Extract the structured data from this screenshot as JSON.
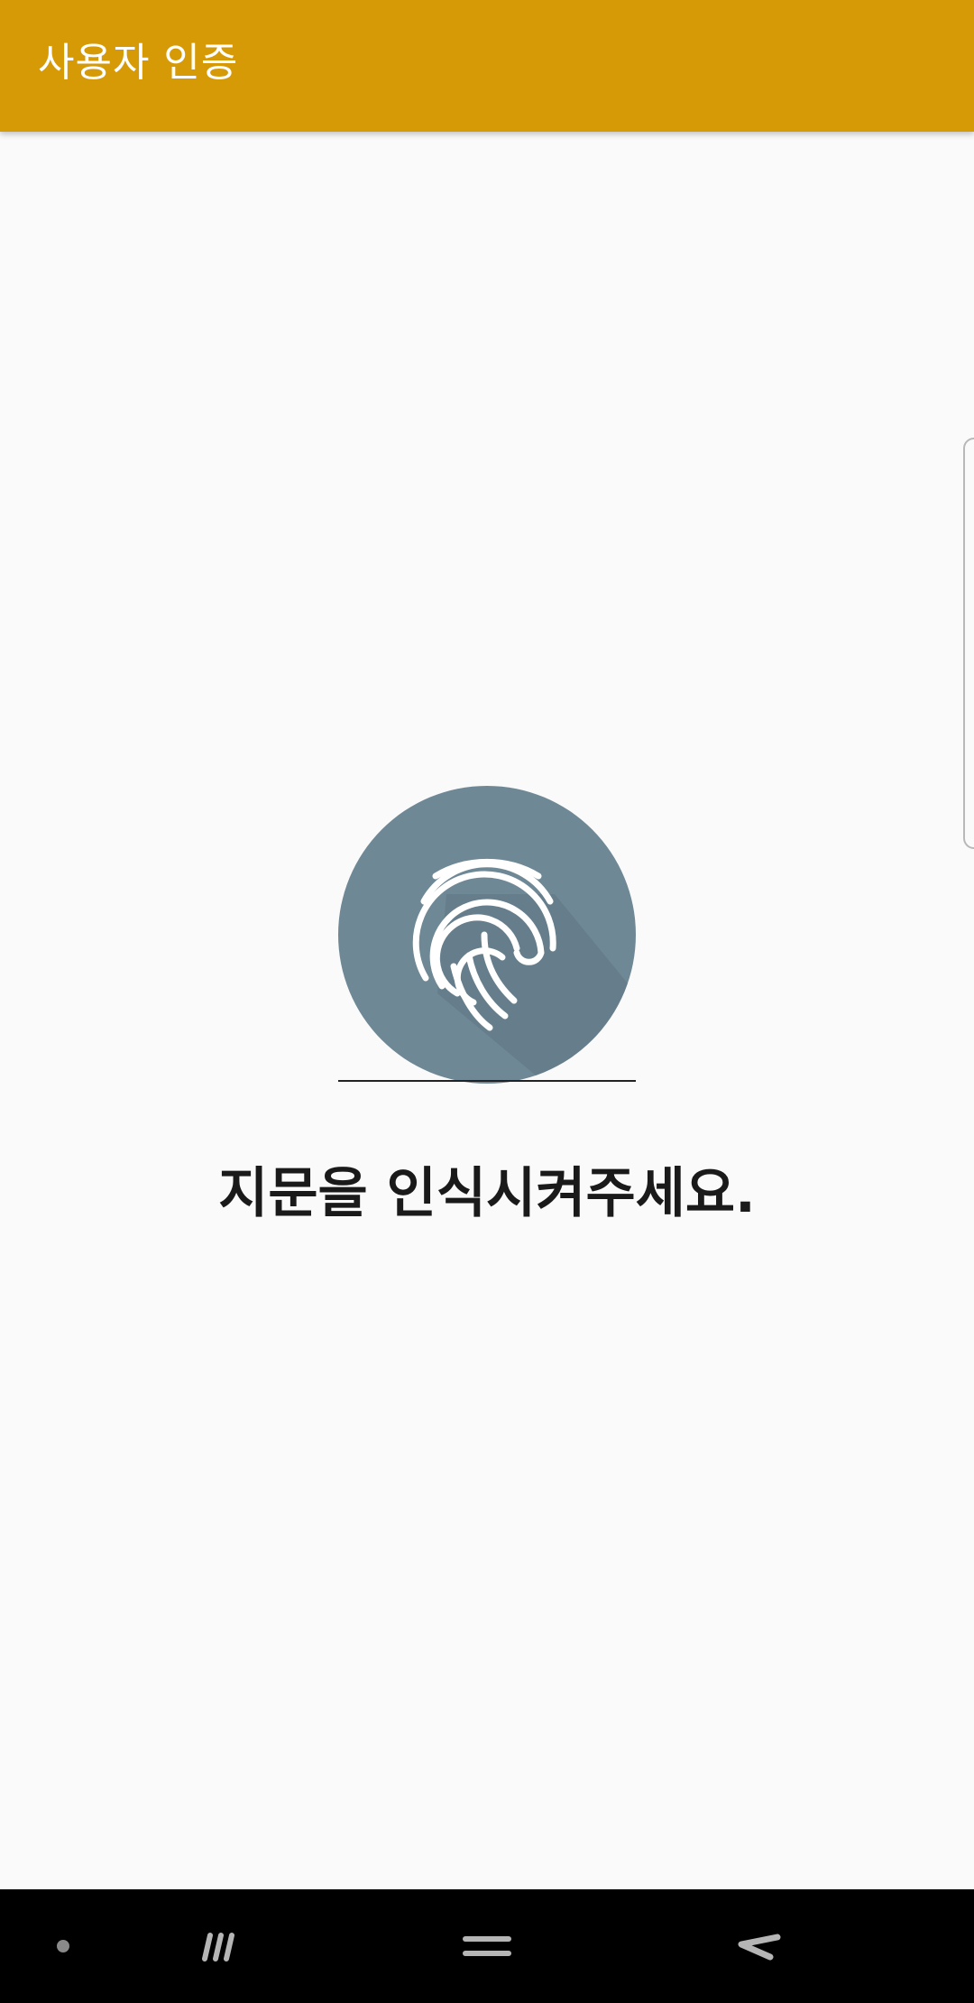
{
  "app_bar": {
    "title": "사용자 인증",
    "background": "#d69a06"
  },
  "fingerprint": {
    "icon": "fingerprint-icon",
    "circle_color": "#6f8896"
  },
  "prompt": {
    "text": "지문을 인식시켜주세요."
  },
  "nav_bar": {
    "items": [
      {
        "icon": "dot-icon"
      },
      {
        "icon": "recent-apps-icon"
      },
      {
        "icon": "home-icon"
      },
      {
        "icon": "back-icon"
      }
    ]
  }
}
